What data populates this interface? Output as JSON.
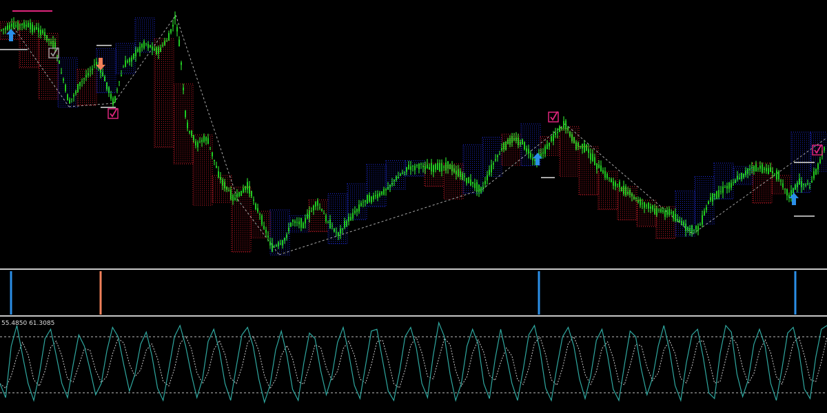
{
  "indicator_subwindow": {
    "readout": "55.4850 61.3085"
  },
  "colors": {
    "background": "#000000",
    "candle_body": "#22cc22",
    "candle_wick": "#33ff33",
    "cloud_blue": "#2233ff",
    "cloud_red": "#ff2233",
    "buy_arrow": "#2b8fe8",
    "sell_arrow": "#f0805a",
    "check_box": "#e0267d",
    "zigzag": "#aaaaaa",
    "separator": "#c8c8c8",
    "oscillator_main": "#2fa8a0",
    "oscillator_signal": "#cccccc",
    "level_line": "#bbbbbb"
  },
  "chart_data": [
    {
      "type": "line",
      "name": "price",
      "points": [
        [
          0,
          44
        ],
        [
          20,
          38
        ],
        [
          35,
          36
        ],
        [
          60,
          45
        ],
        [
          80,
          68
        ],
        [
          100,
          150
        ],
        [
          115,
          125
        ],
        [
          125,
          110
        ],
        [
          140,
          92
        ],
        [
          150,
          110
        ],
        [
          165,
          150
        ],
        [
          180,
          95
        ],
        [
          195,
          80
        ],
        [
          210,
          62
        ],
        [
          230,
          75
        ],
        [
          245,
          55
        ],
        [
          255,
          25
        ],
        [
          262,
          80
        ],
        [
          270,
          180
        ],
        [
          285,
          210
        ],
        [
          300,
          200
        ],
        [
          320,
          260
        ],
        [
          340,
          290
        ],
        [
          360,
          270
        ],
        [
          380,
          320
        ],
        [
          395,
          360
        ],
        [
          410,
          355
        ],
        [
          425,
          320
        ],
        [
          440,
          325
        ],
        [
          460,
          295
        ],
        [
          475,
          320
        ],
        [
          490,
          340
        ],
        [
          510,
          315
        ],
        [
          530,
          290
        ],
        [
          550,
          285
        ],
        [
          570,
          265
        ],
        [
          590,
          245
        ],
        [
          610,
          240
        ],
        [
          630,
          245
        ],
        [
          650,
          240
        ],
        [
          670,
          255
        ],
        [
          690,
          270
        ],
        [
          700,
          275
        ],
        [
          715,
          240
        ],
        [
          730,
          215
        ],
        [
          745,
          200
        ],
        [
          760,
          210
        ],
        [
          775,
          235
        ],
        [
          790,
          220
        ],
        [
          805,
          195
        ],
        [
          820,
          180
        ],
        [
          835,
          210
        ],
        [
          850,
          215
        ],
        [
          870,
          245
        ],
        [
          890,
          265
        ],
        [
          905,
          275
        ],
        [
          930,
          295
        ],
        [
          950,
          305
        ],
        [
          975,
          310
        ],
        [
          1000,
          335
        ],
        [
          1015,
          330
        ],
        [
          1030,
          290
        ],
        [
          1050,
          275
        ],
        [
          1070,
          260
        ],
        [
          1090,
          245
        ],
        [
          1110,
          245
        ],
        [
          1130,
          255
        ],
        [
          1145,
          285
        ],
        [
          1160,
          265
        ],
        [
          1175,
          270
        ],
        [
          1190,
          235
        ],
        [
          1200,
          200
        ]
      ]
    },
    {
      "type": "bar",
      "name": "signal_histogram",
      "bars": [
        {
          "x": 16,
          "direction": "up"
        },
        {
          "x": 146,
          "direction": "down"
        },
        {
          "x": 782,
          "direction": "up"
        },
        {
          "x": 1154,
          "direction": "up"
        }
      ]
    },
    {
      "type": "line",
      "name": "oscillator",
      "levels": [
        80,
        20
      ],
      "ylim": [
        0,
        100
      ],
      "values": [
        30,
        15,
        70,
        92,
        60,
        30,
        12,
        40,
        78,
        88,
        60,
        30,
        15,
        50,
        82,
        70,
        45,
        18,
        30,
        65,
        90,
        80,
        50,
        22,
        40,
        72,
        85,
        60,
        25,
        12,
        45,
        80,
        92,
        70,
        40,
        15,
        35,
        75,
        88,
        65,
        30,
        12,
        48,
        82,
        90,
        70,
        35,
        10,
        28,
        66,
        86,
        60,
        24,
        12,
        52,
        84,
        78,
        44,
        18,
        38,
        74,
        90,
        62,
        28,
        14,
        50,
        86,
        88,
        55,
        22,
        12,
        42,
        80,
        90,
        68,
        30,
        15,
        60,
        95,
        80,
        40,
        12,
        30,
        70,
        88,
        72,
        30,
        14,
        56,
        88,
        60,
        30,
        12,
        45,
        82,
        92,
        65,
        25,
        12,
        48,
        80,
        90,
        70,
        35,
        14,
        38,
        76,
        88,
        60,
        24,
        12,
        50,
        86,
        80,
        45,
        18,
        36,
        70,
        92,
        66,
        28,
        12,
        52,
        82,
        88,
        58,
        20,
        14,
        62,
        92,
        85,
        40,
        16,
        34,
        72,
        88,
        70,
        30,
        12,
        46,
        84,
        90,
        65,
        24,
        14,
        58,
        88,
        92
      ]
    }
  ],
  "markers": {
    "buy_arrows": [
      [
        16,
        52
      ],
      [
        780,
        232
      ],
      [
        1152,
        290
      ]
    ],
    "sell_arrows": [
      [
        146,
        92
      ]
    ],
    "check_boxes": [
      {
        "x": 78,
        "y": 77,
        "color": "gray"
      },
      {
        "x": 164,
        "y": 165,
        "color": "pink"
      },
      {
        "x": 803,
        "y": 170,
        "color": "pink"
      },
      {
        "x": 1186,
        "y": 218,
        "color": "pink"
      }
    ]
  }
}
